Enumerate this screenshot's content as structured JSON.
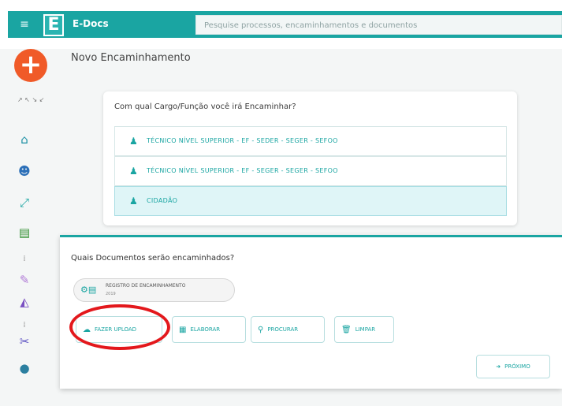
{
  "header": {
    "app_title": "E-Docs",
    "logo_letter": "E",
    "search_placeholder": "Pesquise processos, encaminhamentos e documentos"
  },
  "sidebar": {
    "fab_symbol": "+",
    "tiny_top": "↗ ↖ ↘ ↙"
  },
  "page": {
    "title": "Novo Encaminhamento"
  },
  "role_card": {
    "question": "Com qual Cargo/Função você irá Encaminhar?",
    "options": [
      {
        "label": "TÉCNICO NÍVEL SUPERIOR - EF - SEDER - SEGER - SEFOO",
        "selected": false
      },
      {
        "label": "TÉCNICO NÍVEL SUPERIOR - EF - SEGER - SEGER - SEFOO",
        "selected": false
      },
      {
        "label": "CIDADÃO",
        "selected": true
      }
    ]
  },
  "docs_card": {
    "question": "Quais Documentos serão encaminhados?",
    "document": {
      "name": "REGISTRO DE ENCAMINHAMENTO",
      "sub": "2019"
    },
    "buttons": {
      "upload": "FAZER UPLOAD",
      "elaborate": "ELABORAR",
      "search": "PROCURAR",
      "clear": "LIMPAR",
      "next": "PRÓXIMO"
    }
  },
  "colors": {
    "primary": "#1aa5a2",
    "accent": "#f05a28",
    "highlight": "#e3181c"
  }
}
